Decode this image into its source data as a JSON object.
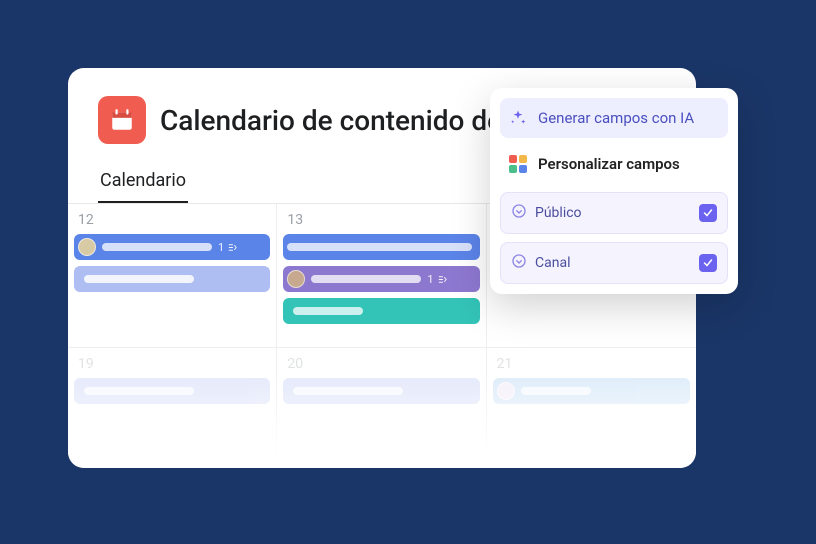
{
  "header": {
    "title": "Calendario de contenido de"
  },
  "tabs": {
    "calendar": "Calendario"
  },
  "days": {
    "d1": "12",
    "d2": "13",
    "d3": "",
    "d4": "19",
    "d5": "20",
    "d6": "21"
  },
  "tasks": {
    "t1_count": "1",
    "t2_count": "1"
  },
  "popover": {
    "generate_ai": "Generar campos con IA",
    "customize": "Personalizar campos",
    "field_publico": "Público",
    "field_canal": "Canal"
  }
}
